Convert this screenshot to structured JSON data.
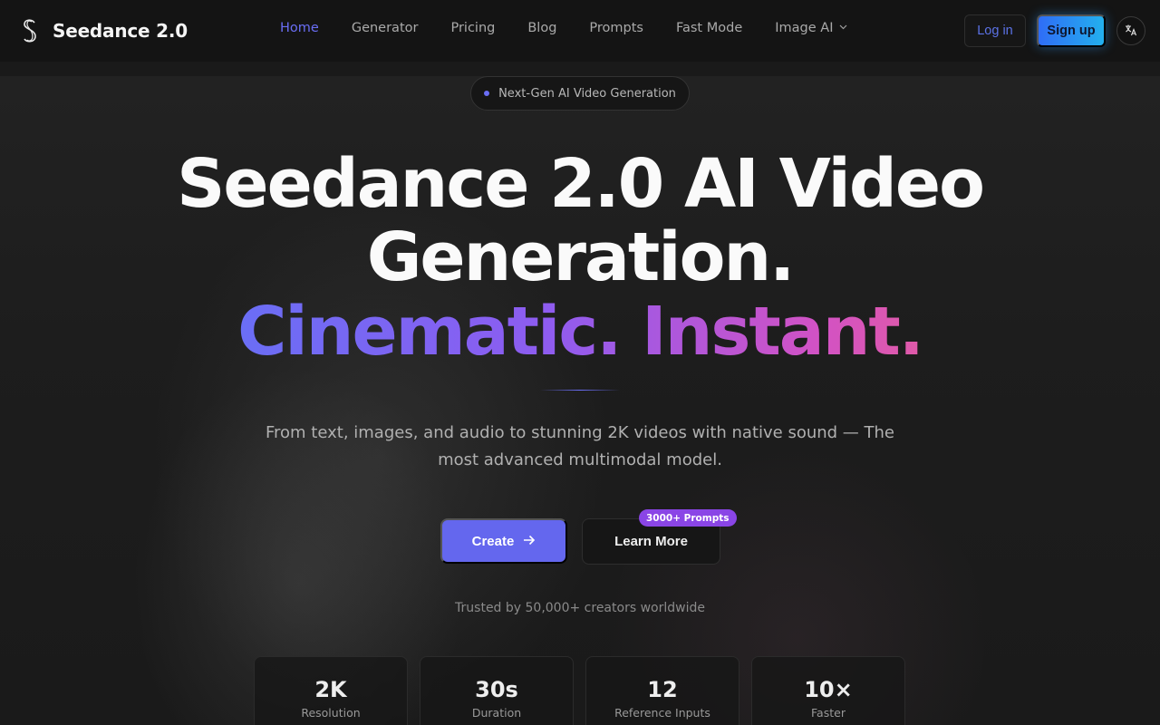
{
  "brand": {
    "name": "Seedance 2.0",
    "logo_icon": "s-logo-icon"
  },
  "nav": {
    "links": [
      {
        "label": "Home",
        "active": true
      },
      {
        "label": "Generator"
      },
      {
        "label": "Pricing"
      },
      {
        "label": "Blog"
      },
      {
        "label": "Prompts"
      },
      {
        "label": "Fast Mode"
      },
      {
        "label": "Image AI",
        "dropdown": true
      }
    ],
    "login_label": "Log in",
    "signup_label": "Sign up",
    "language_icon": "translate-icon"
  },
  "hero": {
    "pill_text": "Next-Gen AI Video Generation",
    "title_line1": "Seedance 2.0 AI Video",
    "title_line2": "Generation.",
    "title_line3": "Cinematic. Instant.",
    "subtitle": "From text, images, and audio to stunning 2K videos with native sound — The most advanced multimodal model.",
    "create_label": "Create",
    "learn_more_label": "Learn More",
    "prompts_badge": "3000+ Prompts",
    "trusted_text": "Trusted by 50,000+ creators worldwide"
  },
  "stats": [
    {
      "value": "2K",
      "label": "Resolution"
    },
    {
      "value": "30s",
      "label": "Duration"
    },
    {
      "value": "12",
      "label": "Reference Inputs"
    },
    {
      "value": "10×",
      "label": "Faster"
    }
  ],
  "colors": {
    "accent": "#6a6ef5",
    "signup_gradient_start": "#2f6df6",
    "signup_gradient_end": "#23b0ee",
    "badge": "#8a45e6",
    "headline_gradient_end": "#e05aa8"
  }
}
